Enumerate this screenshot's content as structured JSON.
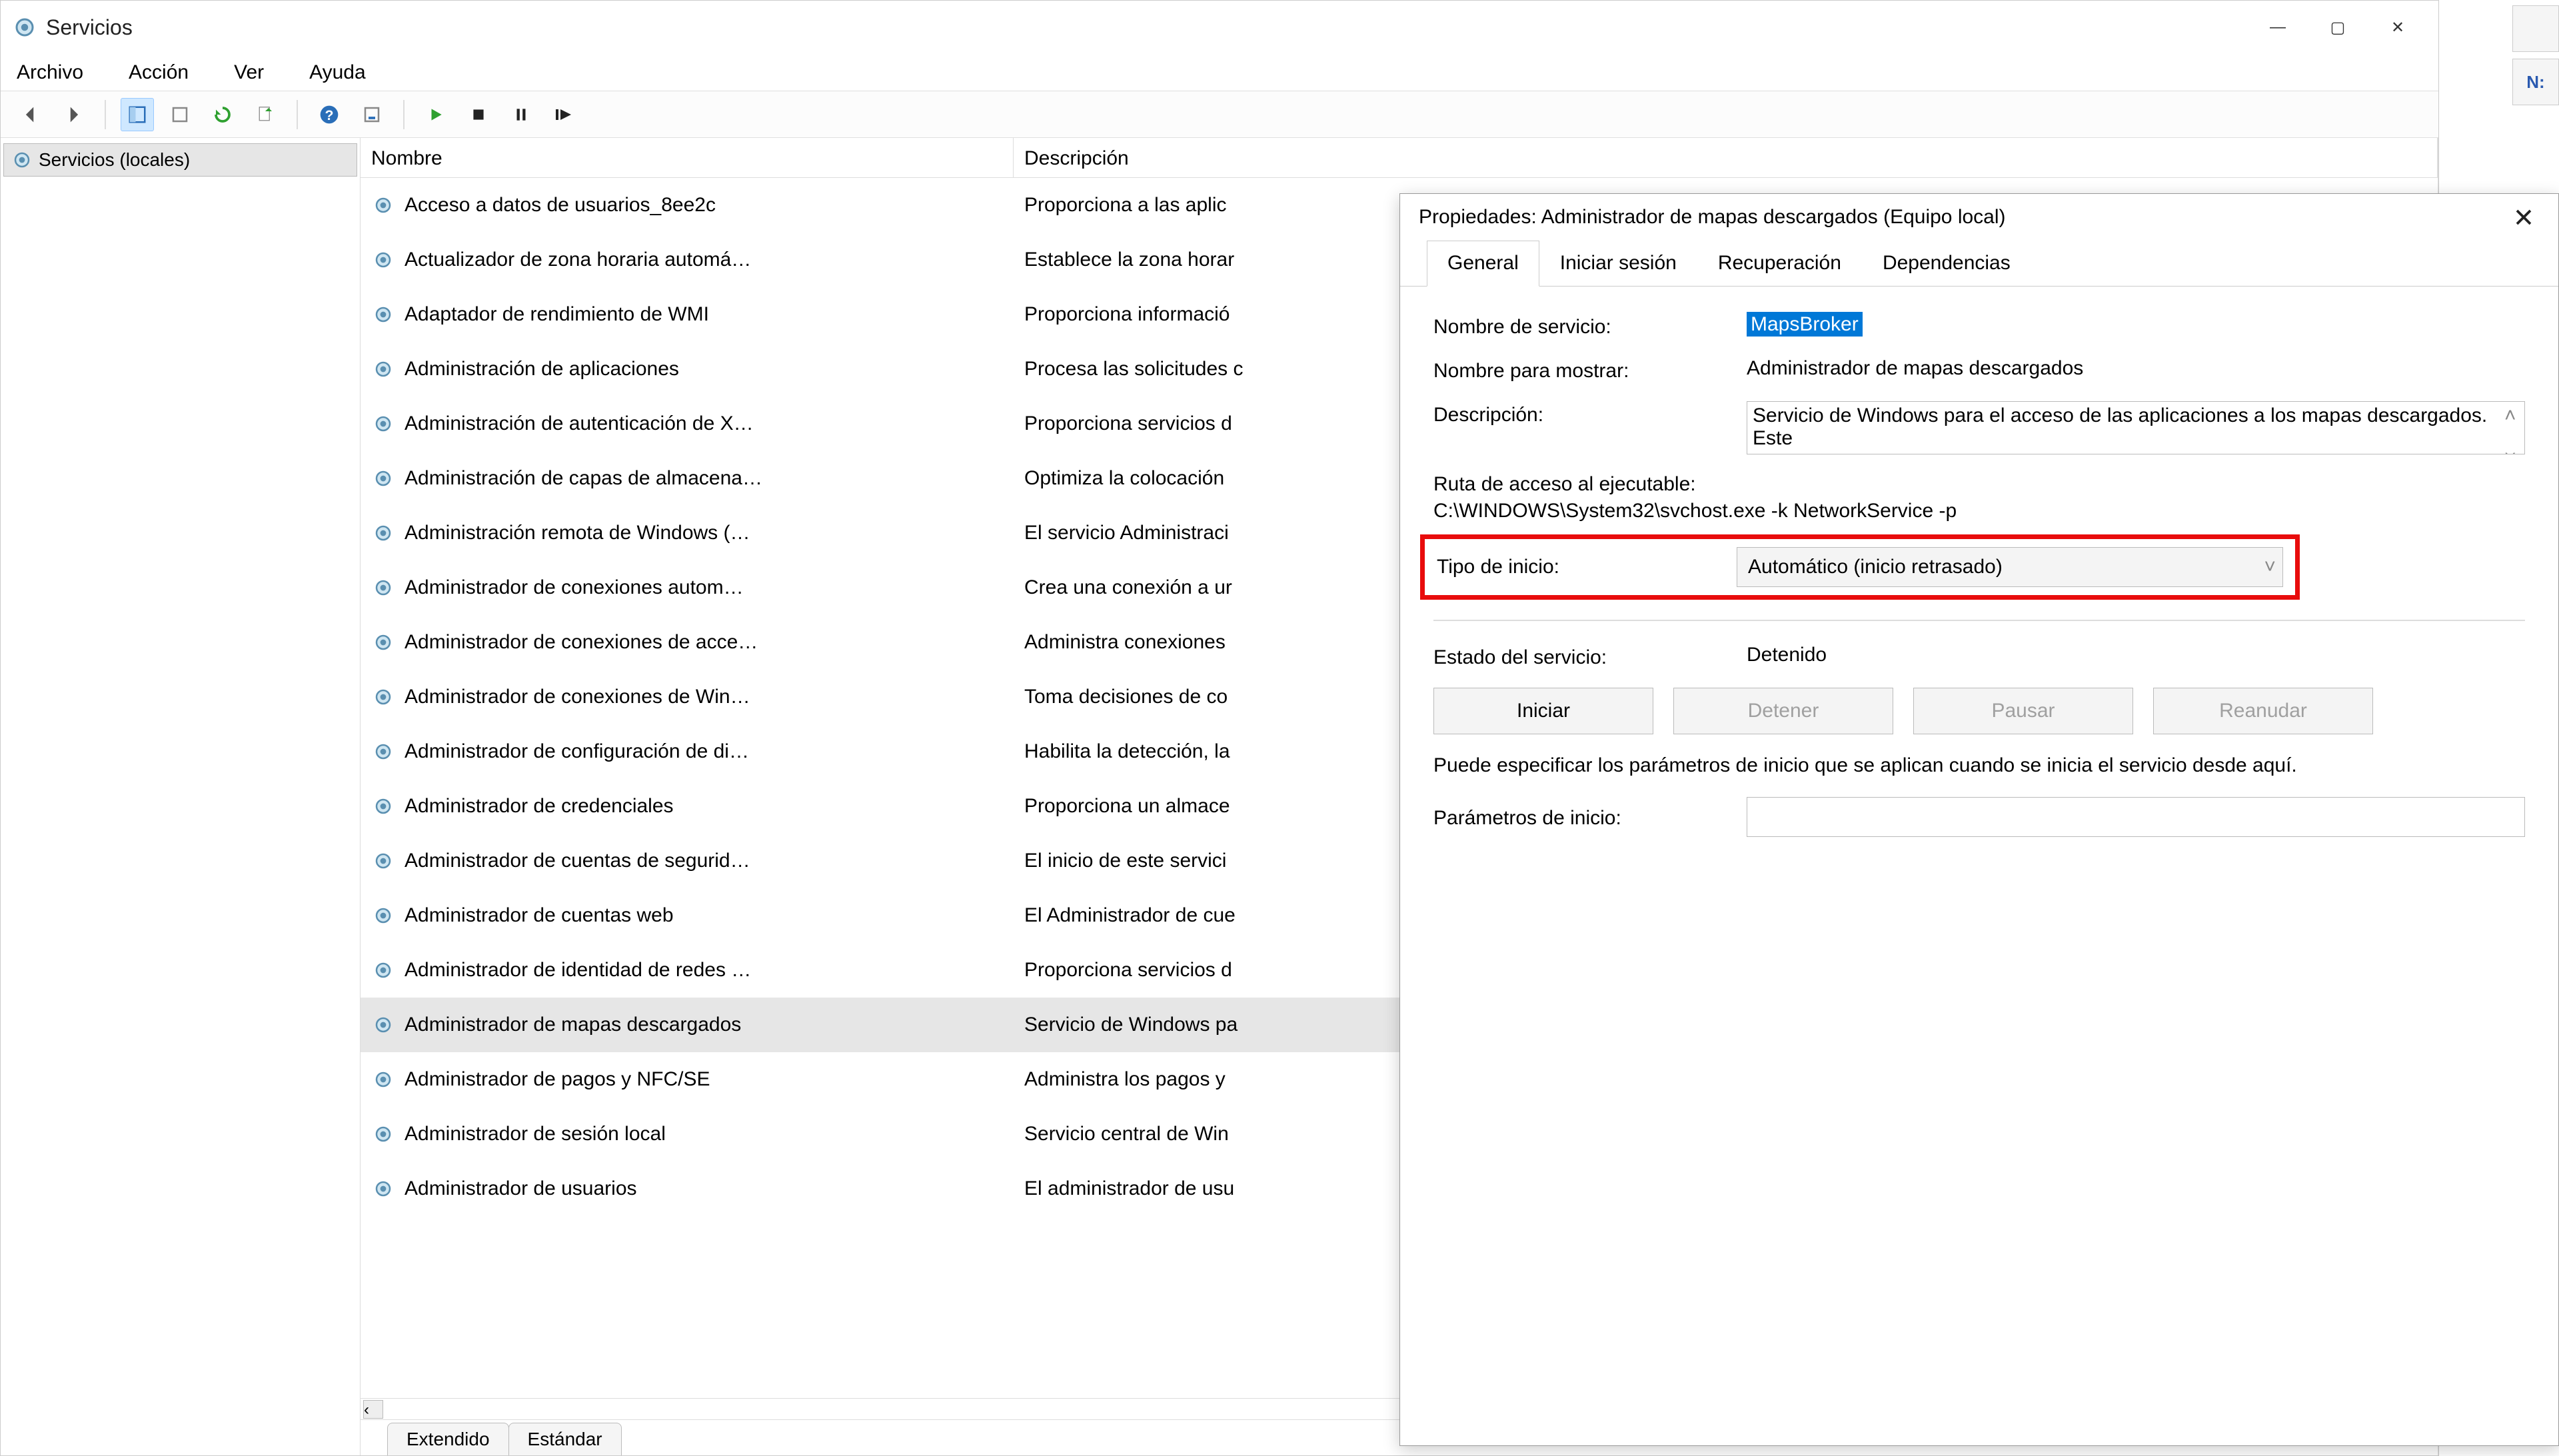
{
  "window": {
    "title": "Servicios"
  },
  "window_controls": {
    "min": "—",
    "max": "▢",
    "close": "✕"
  },
  "menubar": {
    "items": [
      "Archivo",
      "Acción",
      "Ver",
      "Ayuda"
    ]
  },
  "tree": {
    "root": "Servicios (locales)"
  },
  "list": {
    "columns": {
      "name": "Nombre",
      "desc": "Descripción"
    },
    "rows": [
      {
        "name": "Acceso a datos de usuarios_8ee2c",
        "desc": "Proporciona a las aplic"
      },
      {
        "name": "Actualizador de zona horaria automá…",
        "desc": "Establece la zona horar"
      },
      {
        "name": "Adaptador de rendimiento de WMI",
        "desc": "Proporciona informació"
      },
      {
        "name": "Administración de aplicaciones",
        "desc": "Procesa las solicitudes c"
      },
      {
        "name": "Administración de autenticación de X…",
        "desc": "Proporciona servicios d"
      },
      {
        "name": "Administración de capas de almacena…",
        "desc": "Optimiza la colocación"
      },
      {
        "name": "Administración remota de Windows (…",
        "desc": "El servicio Administraci"
      },
      {
        "name": "Administrador de conexiones autom…",
        "desc": "Crea una conexión a ur"
      },
      {
        "name": "Administrador de conexiones de acce…",
        "desc": "Administra conexiones"
      },
      {
        "name": "Administrador de conexiones de Win…",
        "desc": "Toma decisiones de co"
      },
      {
        "name": "Administrador de configuración de di…",
        "desc": "Habilita la detección, la"
      },
      {
        "name": "Administrador de credenciales",
        "desc": "Proporciona un almace"
      },
      {
        "name": "Administrador de cuentas de segurid…",
        "desc": "El inicio de este servici"
      },
      {
        "name": "Administrador de cuentas web",
        "desc": "El Administrador de cue"
      },
      {
        "name": "Administrador de identidad de redes …",
        "desc": "Proporciona servicios d"
      },
      {
        "name": "Administrador de mapas descargados",
        "desc": "Servicio de Windows pa",
        "selected": true
      },
      {
        "name": "Administrador de pagos y NFC/SE",
        "desc": "Administra los pagos y"
      },
      {
        "name": "Administrador de sesión local",
        "desc": "Servicio central de Win"
      },
      {
        "name": "Administrador de usuarios",
        "desc": "El administrador de usu"
      }
    ]
  },
  "bottom_tabs": {
    "extended": "Extendido",
    "standard": "Estándar"
  },
  "dialog": {
    "title": "Propiedades: Administrador de mapas descargados (Equipo local)",
    "tabs": {
      "general": "General",
      "logon": "Iniciar sesión",
      "recovery": "Recuperación",
      "dependencies": "Dependencias"
    },
    "labels": {
      "service_name": "Nombre de servicio:",
      "display_name": "Nombre para mostrar:",
      "description": "Descripción:",
      "exe_path": "Ruta de acceso al ejecutable:",
      "startup_type": "Tipo de inicio:",
      "service_state": "Estado del servicio:",
      "start_params_hint": "Puede especificar los parámetros de inicio que se aplican cuando se inicia el servicio desde aquí.",
      "start_params": "Parámetros de inicio:"
    },
    "values": {
      "service_name": "MapsBroker",
      "display_name": "Administrador de mapas descargados",
      "description": "Servicio de Windows para el acceso de las aplicaciones a los mapas descargados. Este",
      "exe_path": "C:\\WINDOWS\\System32\\svchost.exe -k NetworkService -p",
      "startup_type": "Automático (inicio retrasado)",
      "service_state": "Detenido"
    },
    "buttons": {
      "start": "Iniciar",
      "stop": "Detener",
      "pause": "Pausar",
      "resume": "Reanudar"
    }
  },
  "edge": {
    "top": "",
    "ne": "N:"
  }
}
